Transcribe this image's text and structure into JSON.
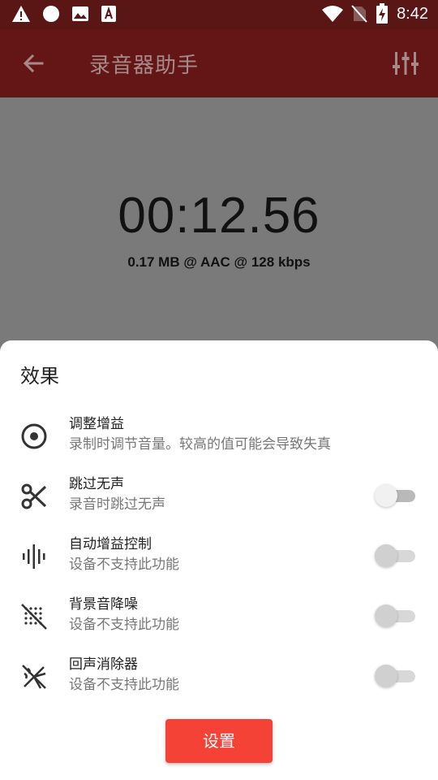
{
  "status_bar": {
    "time": "8:42",
    "icons": [
      "warning-icon",
      "circle-icon",
      "image-icon",
      "font-icon",
      "wifi-icon",
      "no-sim-icon",
      "battery-charging-icon"
    ]
  },
  "app_bar": {
    "title": "录音器助手",
    "back_icon": "arrow-left-icon",
    "tune_icon": "tune-icon"
  },
  "recorder": {
    "timer": "00:12.56",
    "file_info": "0.17 MB @ AAC @ 128 kbps"
  },
  "sheet": {
    "title": "效果",
    "options": [
      {
        "title": "调整增益",
        "subtitle": "录制时调节音量。较高的值可能会导致失真",
        "icon": "target-icon",
        "has_switch": false
      },
      {
        "title": "跳过无声",
        "subtitle": "录音时跳过无声",
        "icon": "scissors-icon",
        "has_switch": true,
        "switch_on": false,
        "switch_enabled": true
      },
      {
        "title": "自动增益控制",
        "subtitle": "设备不支持此功能",
        "icon": "waveform-icon",
        "has_switch": true,
        "switch_on": false,
        "switch_enabled": false
      },
      {
        "title": "背景音降噪",
        "subtitle": "设备不支持此功能",
        "icon": "noise-reduction-icon",
        "has_switch": true,
        "switch_on": false,
        "switch_enabled": false
      },
      {
        "title": "回声消除器",
        "subtitle": "设备不支持此功能",
        "icon": "echo-cancel-icon",
        "has_switch": true,
        "switch_on": false,
        "switch_enabled": false
      }
    ],
    "button_label": "设置"
  },
  "colors": {
    "status_bar": "#5a1515",
    "app_bar": "#641515",
    "button": "#f44336"
  }
}
